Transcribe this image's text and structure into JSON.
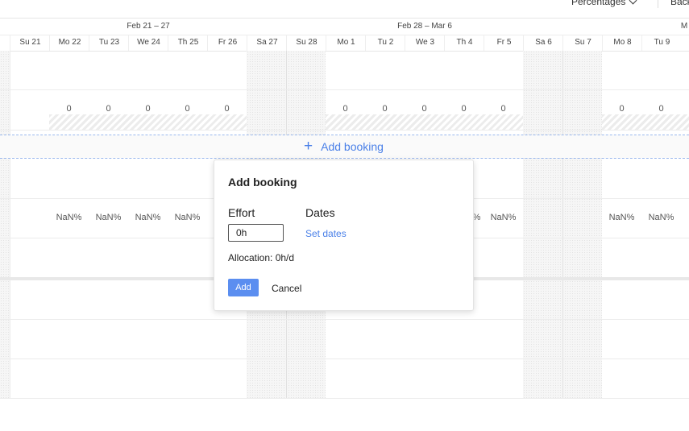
{
  "toolbar": {
    "view_mode": "Percentages",
    "back_label": "Back"
  },
  "weeks": [
    "Feb 21 – 27",
    "Feb 28 – Mar 6",
    "M"
  ],
  "days": [
    "Su 21",
    "Mo 22",
    "Tu 23",
    "We 24",
    "Th 25",
    "Fr 26",
    "Sa 27",
    "Su 28",
    "Mo 1",
    "Tu 2",
    "We 3",
    "Th 4",
    "Fr 5",
    "Sa 6",
    "Su 7",
    "Mo 8",
    "Tu 9"
  ],
  "capacity_row": [
    "0",
    "0",
    "0",
    "0",
    "0",
    "0",
    "0",
    "0",
    "0",
    "0",
    "0",
    "0"
  ],
  "percent_row": [
    "NaN%",
    "NaN%",
    "NaN%",
    "NaN%",
    "%",
    "NaN%",
    "NaN%",
    "NaN%"
  ],
  "add_booking_link": "Add booking",
  "popup": {
    "title": "Add booking",
    "effort_label": "Effort",
    "effort_value": "0h",
    "dates_label": "Dates",
    "set_dates_link": "Set dates",
    "allocation": "Allocation: 0h/d",
    "add_button": "Add",
    "cancel_button": "Cancel"
  },
  "colors": {
    "accent": "#4a80e8",
    "primary_button": "#5b8ef0",
    "dashed_border": "#9ab8ee"
  }
}
